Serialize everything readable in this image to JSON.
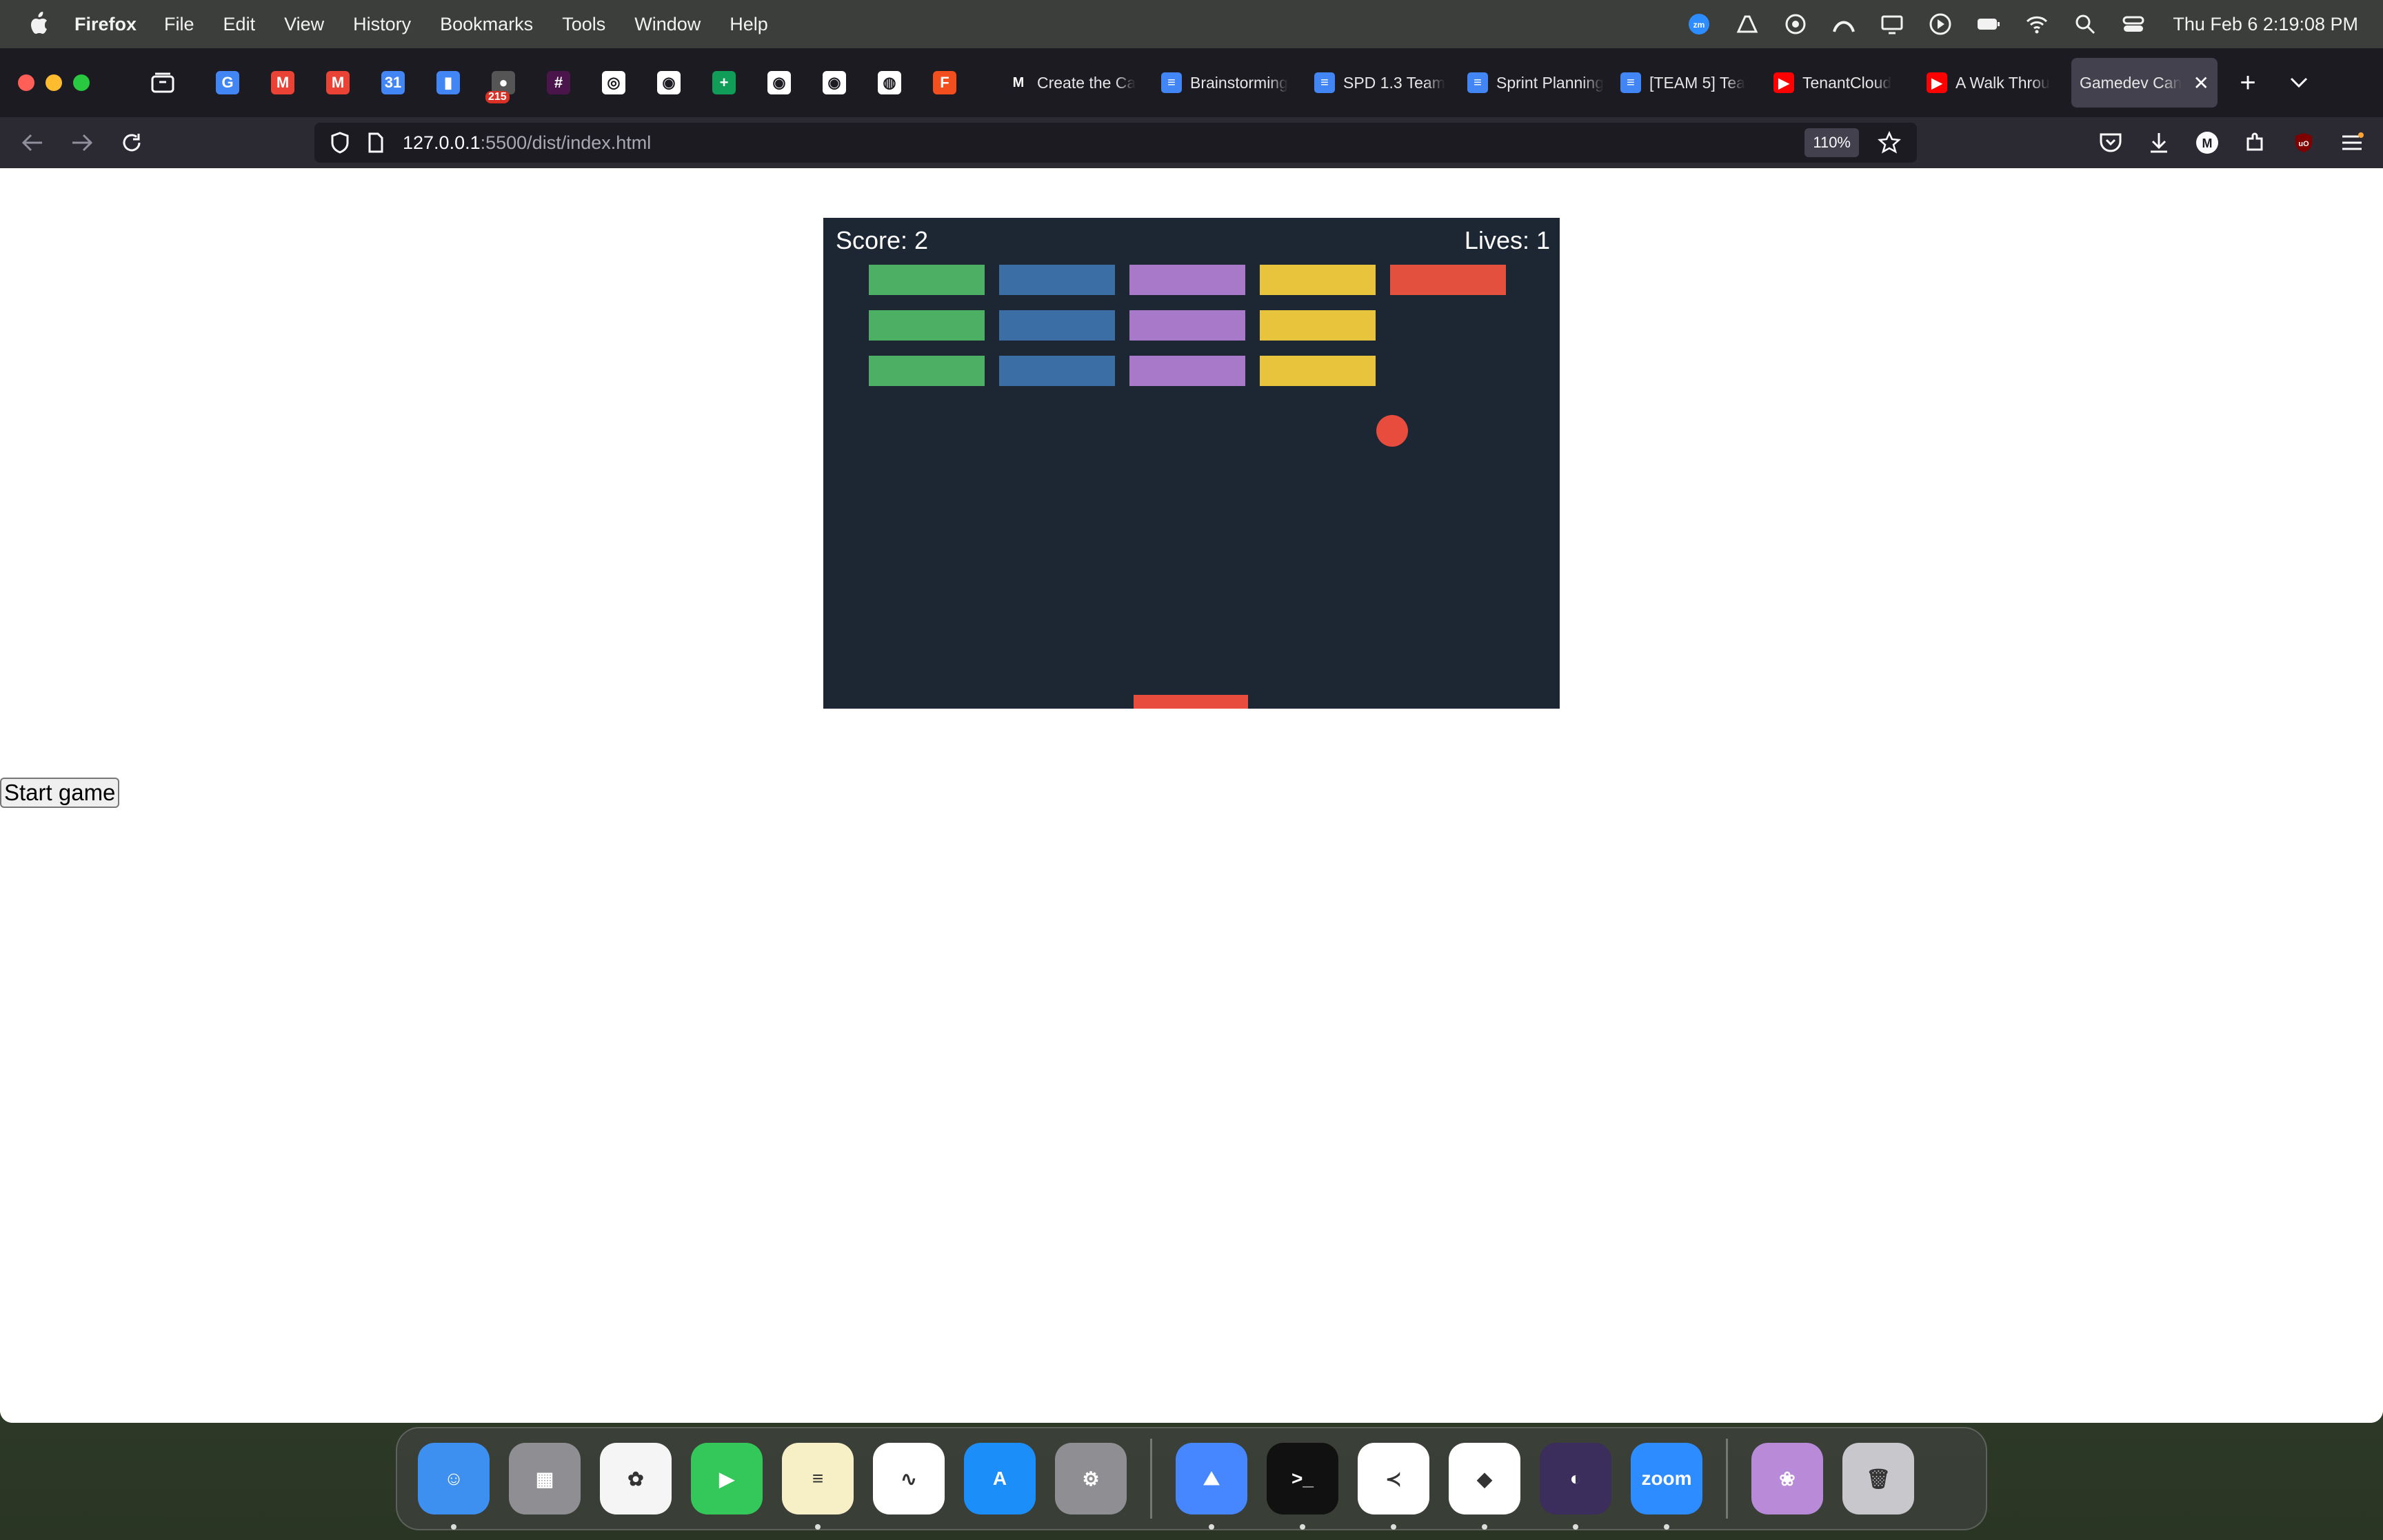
{
  "menubar": {
    "app_name": "Firefox",
    "items": [
      "File",
      "Edit",
      "View",
      "History",
      "Bookmarks",
      "Tools",
      "Window",
      "Help"
    ],
    "status_icons": [
      "zoom-icon",
      "drive-icon",
      "screen-record-icon",
      "vpn-icon",
      "display-icon",
      "play-icon",
      "battery-icon",
      "wifi-icon",
      "spotlight-icon",
      "control-center-icon"
    ],
    "clock": "Thu Feb 6  2:19:08 PM"
  },
  "browser": {
    "pinned_tabs": [
      {
        "icon": "translate-icon",
        "color": "#4285f4",
        "glyph": "G"
      },
      {
        "icon": "gmail-icon",
        "color": "#ea4335",
        "glyph": "M"
      },
      {
        "icon": "gmail-icon",
        "color": "#ea4335",
        "glyph": "M"
      },
      {
        "icon": "calendar-icon",
        "color": "#4285f4",
        "glyph": "31"
      },
      {
        "icon": "analytics-icon",
        "color": "#4285f4",
        "glyph": "▮"
      },
      {
        "icon": "notifications-icon",
        "color": "#555555",
        "glyph": "●",
        "badge": "215"
      },
      {
        "icon": "slack-icon",
        "color": "#4a154b",
        "glyph": "#"
      },
      {
        "icon": "chatgpt-icon",
        "color": "#ffffff",
        "glyph": "◎"
      },
      {
        "icon": "github-icon",
        "color": "#ffffff",
        "glyph": "◉"
      },
      {
        "icon": "sheets-icon",
        "color": "#0f9d58",
        "glyph": "+"
      },
      {
        "icon": "github-icon",
        "color": "#ffffff",
        "glyph": "◉"
      },
      {
        "icon": "github-icon",
        "color": "#ffffff",
        "glyph": "◉"
      },
      {
        "icon": "globe-icon",
        "color": "#ffffff",
        "glyph": "◍"
      },
      {
        "icon": "figma-icon",
        "color": "#f24e1e",
        "glyph": "F"
      }
    ],
    "tabs": [
      {
        "label": "Create the Ca",
        "icon": "medium-icon",
        "color": "#1c1b22",
        "glyph": "M"
      },
      {
        "label": "Brainstorming",
        "icon": "docs-icon",
        "color": "#4285f4",
        "glyph": "≡"
      },
      {
        "label": "SPD 1.3 Team",
        "icon": "docs-icon",
        "color": "#4285f4",
        "glyph": "≡"
      },
      {
        "label": "Sprint Planning",
        "icon": "docs-icon",
        "color": "#4285f4",
        "glyph": "≡"
      },
      {
        "label": "[TEAM 5] Tea",
        "icon": "docs-icon",
        "color": "#4285f4",
        "glyph": "≡"
      },
      {
        "label": "TenantCloud",
        "icon": "youtube-icon",
        "color": "#ff0000",
        "glyph": "▶"
      },
      {
        "label": "A Walk Throu",
        "icon": "youtube-icon",
        "color": "#ff0000",
        "glyph": "▶"
      }
    ],
    "active_tab": {
      "label": "Gamedev Can",
      "close": "✕"
    },
    "new_tab": "+",
    "url_host": "127.0.0.1",
    "url_path": ":5500/dist/index.html",
    "zoom": "110%"
  },
  "game": {
    "score_label": "Score: 2",
    "lives_label": "Lives: 1",
    "start_button": "Start game",
    "background": "#1d2733",
    "columns": [
      {
        "color": "#4caf63",
        "rows": 3
      },
      {
        "color": "#3a6ea5",
        "rows": 3
      },
      {
        "color": "#a879c9",
        "rows": 3
      },
      {
        "color": "#e7c43c",
        "rows": 3
      },
      {
        "color": "#e4503e",
        "rows": 1
      }
    ],
    "ball_color": "#e74c3c",
    "paddle_color": "#e74c3c"
  },
  "dock": {
    "apps": [
      {
        "name": "finder",
        "color": "#3d8ff0",
        "glyph": "☺",
        "running": true
      },
      {
        "name": "launchpad",
        "color": "#8e8e93",
        "glyph": "▦",
        "running": false
      },
      {
        "name": "photos",
        "color": "#f5f5f5",
        "glyph": "✿",
        "running": false
      },
      {
        "name": "facetime",
        "color": "#34c759",
        "glyph": "▶",
        "running": false
      },
      {
        "name": "notes",
        "color": "#f7f0c6",
        "glyph": "≡",
        "running": true
      },
      {
        "name": "freeform",
        "color": "#ffffff",
        "glyph": "∿",
        "running": false
      },
      {
        "name": "app-store",
        "color": "#1c8ef9",
        "glyph": "A",
        "running": false
      },
      {
        "name": "system-settings",
        "color": "#8e8e93",
        "glyph": "⚙",
        "running": false
      },
      {
        "name": "nordvpn",
        "color": "#4687ff",
        "glyph": "⛰",
        "running": true
      },
      {
        "name": "terminal",
        "color": "#111111",
        "glyph": ">_",
        "running": true
      },
      {
        "name": "vscode",
        "color": "#ffffff",
        "glyph": "≺",
        "running": true
      },
      {
        "name": "brave",
        "color": "#ffffff",
        "glyph": "◆",
        "running": true
      },
      {
        "name": "firefox",
        "color": "#3b2d5c",
        "glyph": "◐",
        "running": true
      },
      {
        "name": "zoom",
        "color": "#2d8cff",
        "glyph": "zoom",
        "running": true
      },
      {
        "name": "wallpaper-preview",
        "color": "#b98ad8",
        "glyph": "❀",
        "running": false
      },
      {
        "name": "trash",
        "color": "#c7c7cc",
        "glyph": "🗑",
        "running": false
      }
    ]
  }
}
